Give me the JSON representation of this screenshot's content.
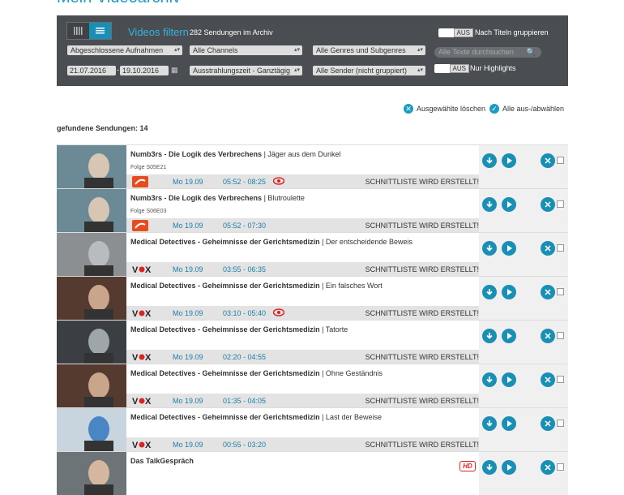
{
  "page": {
    "title": "Mein Videoarchiv"
  },
  "filter": {
    "title": "Videos filtern",
    "count_text": "282 Sendungen im Archiv",
    "group_toggle_state": "AUS",
    "group_toggle_label": "Nach Titeln gruppieren",
    "highlight_toggle_state": "AUS",
    "highlight_toggle_label": "Nur Highlights",
    "recordings_select": "Abgeschlossene Aufnahmen",
    "channels_select": "Alle Channels",
    "genres_select": "Alle Genres und Subgenres",
    "search_placeholder": "Alle Texte durchsuchen",
    "date_from": "21.07.2016",
    "date_sep": "-",
    "date_to": "19.10.2016",
    "airtime_select": "Ausstrahlungszeit - Ganztägig",
    "sender_select": "Alle Sender (nicht gruppiert)"
  },
  "actions": {
    "delete_selected": "Ausgewählte löschen",
    "select_all": "Alle aus-/abwählen"
  },
  "results": {
    "count_label": "gefundene Sendungen: 14"
  },
  "recordings": [
    {
      "series": "Numb3rs - Die Logik des Verbrechens",
      "episode_title": " | Jäger aus dem Dunkel",
      "episode": "Folge S05E21",
      "channel": "kabel eins",
      "date": "Mo 19.09",
      "time": "05:52 - 08:25",
      "status": "SCHNITTLISTE WIRD ERSTELLT!",
      "seen": true
    },
    {
      "series": "Numb3rs - Die Logik des Verbrechens",
      "episode_title": " | Blutroulette",
      "episode": "Folge S06E03",
      "channel": "kabel eins",
      "date": "Mo 19.09",
      "time": "05:52 - 07:30",
      "status": "SCHNITTLISTE WIRD ERSTELLT!",
      "seen": false
    },
    {
      "series": "Medical Detectives - Geheimnisse der Gerichtsmedizin",
      "episode_title": " | Der entscheidende Beweis",
      "episode": "",
      "channel": "VOX",
      "date": "Mo 19.09",
      "time": "03:55 - 06:35",
      "status": "SCHNITTLISTE WIRD ERSTELLT!",
      "seen": false
    },
    {
      "series": "Medical Detectives - Geheimnisse der Gerichtsmedizin",
      "episode_title": " | Ein falsches Wort",
      "episode": "",
      "channel": "VOX",
      "date": "Mo 19.09",
      "time": "03:10 - 05:40",
      "status": "SCHNITTLISTE WIRD ERSTELLT!",
      "seen": true
    },
    {
      "series": "Medical Detectives - Geheimnisse der Gerichtsmedizin",
      "episode_title": " | Tatorte",
      "episode": "",
      "channel": "VOX",
      "date": "Mo 19.09",
      "time": "02:20 - 04:55",
      "status": "SCHNITTLISTE WIRD ERSTELLT!",
      "seen": false
    },
    {
      "series": "Medical Detectives - Geheimnisse der Gerichtsmedizin",
      "episode_title": " | Ohne Geständnis",
      "episode": "",
      "channel": "VOX",
      "date": "Mo 19.09",
      "time": "01:35 - 04:05",
      "status": "SCHNITTLISTE WIRD ERSTELLT!",
      "seen": false
    },
    {
      "series": "Medical Detectives - Geheimnisse der Gerichtsmedizin",
      "episode_title": " | Last der Beweise",
      "episode": "",
      "channel": "VOX",
      "date": "Mo 19.09",
      "time": "00:55 - 03:20",
      "status": "SCHNITTLISTE WIRD ERSTELLT!",
      "seen": false
    },
    {
      "series": "Das TalkGespräch",
      "episode_title": "",
      "episode": "",
      "channel": "",
      "date": "",
      "time": "",
      "status": "",
      "seen": false,
      "hd": "HD"
    }
  ]
}
